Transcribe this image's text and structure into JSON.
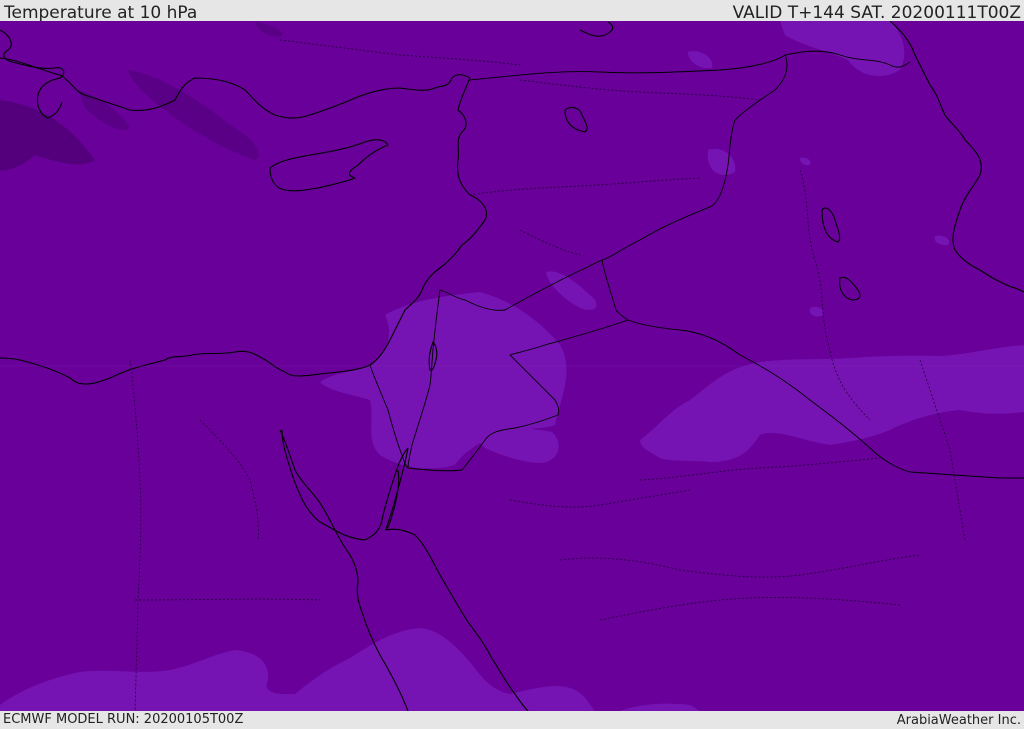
{
  "header": {
    "title": "Temperature at 10 hPa",
    "valid": "VALID T+144 SAT. 20200111T00Z"
  },
  "footer": {
    "model_run": "ECMWF MODEL RUN: 20200105T00Z",
    "credit": "ArabiaWeather Inc."
  },
  "colors": {
    "base_field": "#680099",
    "warmer_band": "#7614b3",
    "colder_band": "#54007d",
    "coastline": "#000000",
    "borders": "#1a0033",
    "chrome": "#e6e6e6"
  }
}
